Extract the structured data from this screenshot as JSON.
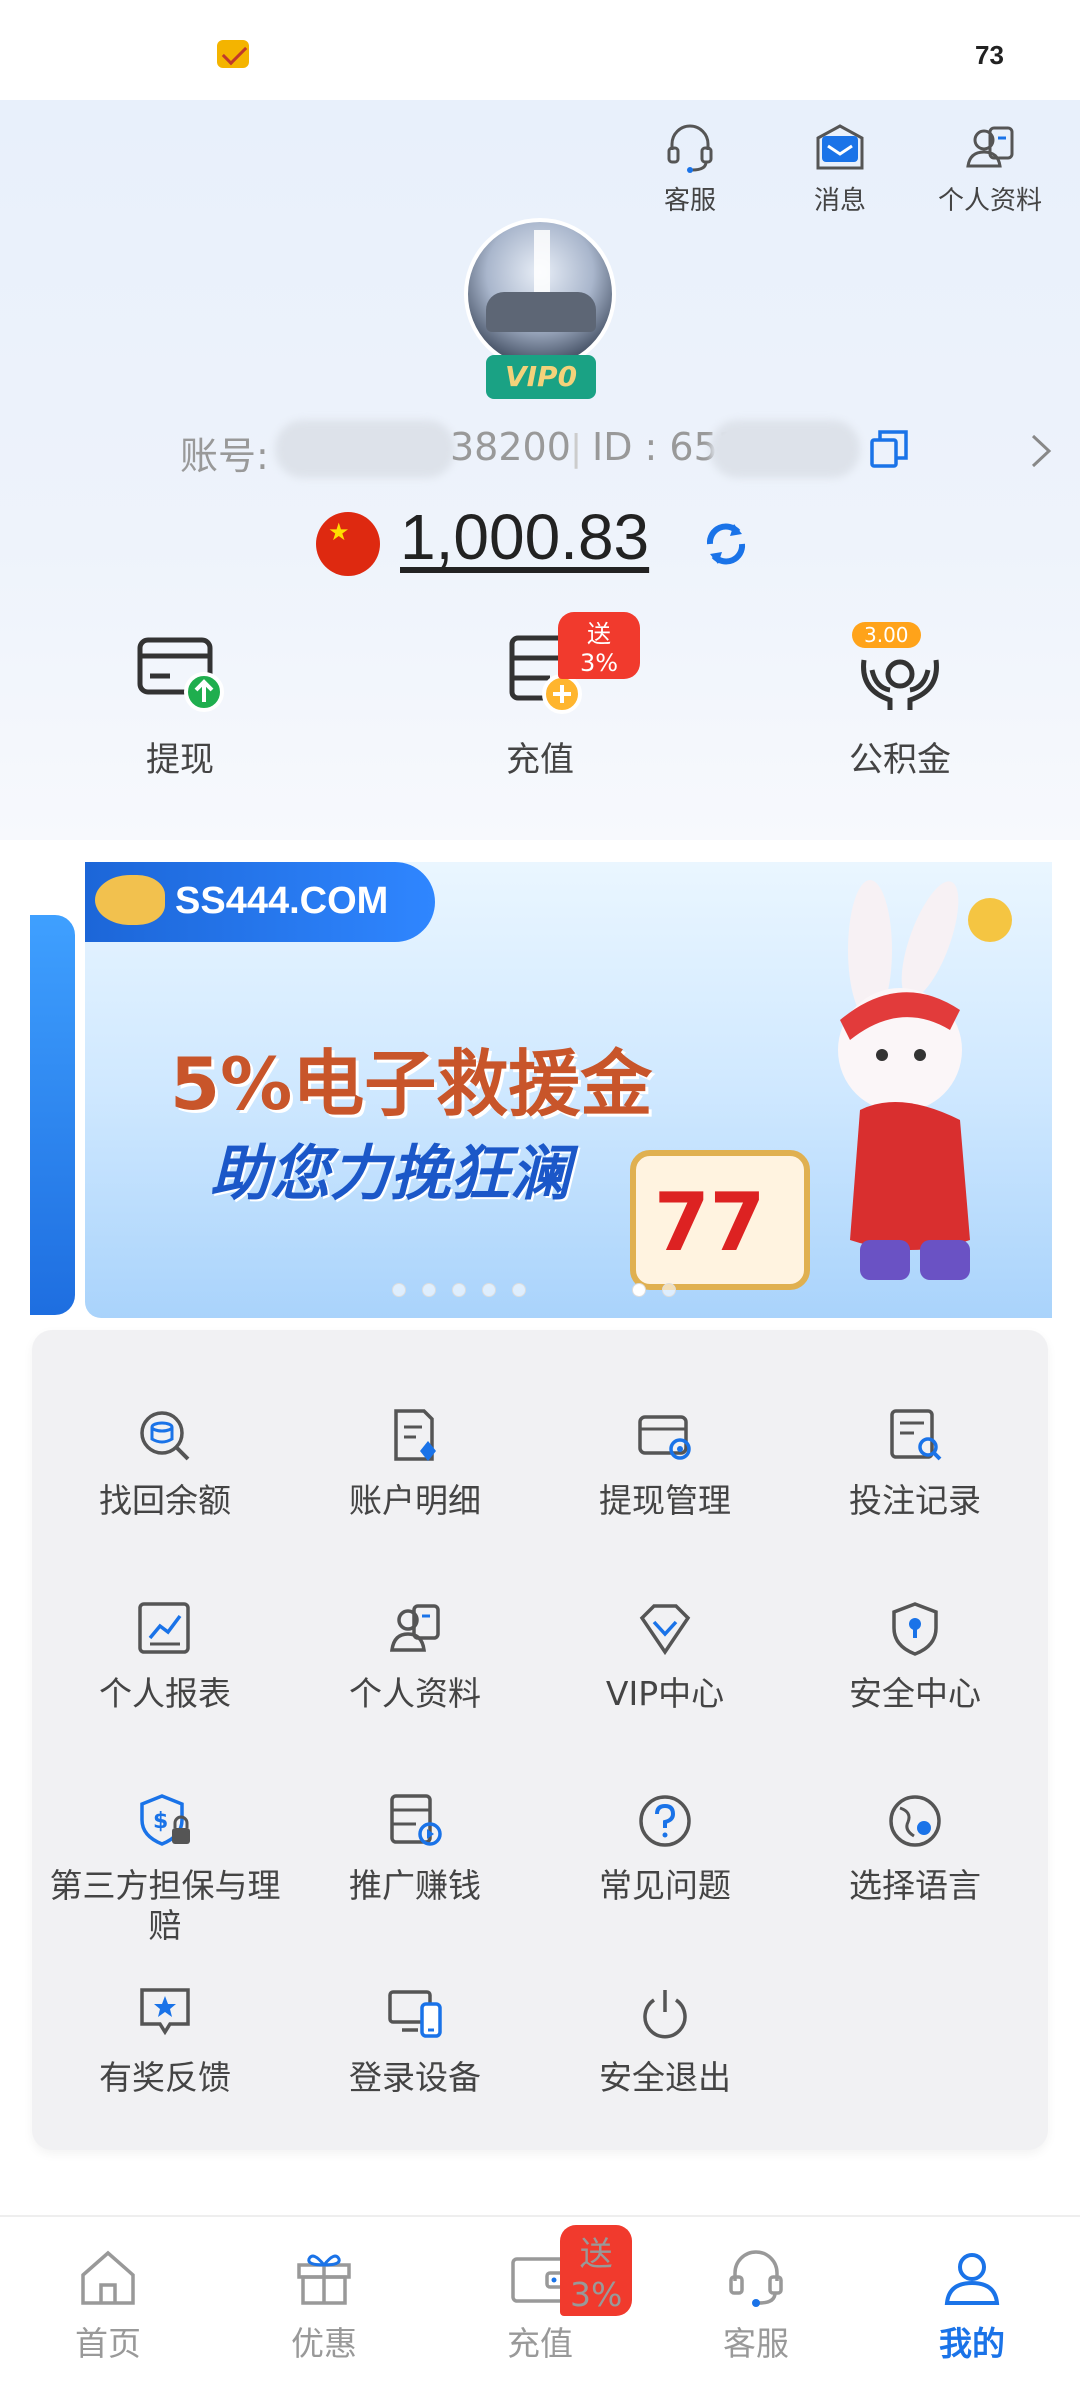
{
  "status_bar": {
    "battery": "73"
  },
  "header": {
    "actions": [
      {
        "label": "客服"
      },
      {
        "label": "消息"
      },
      {
        "label": "个人资料"
      }
    ],
    "vip_label": "VIP0",
    "account_label": "账号:",
    "account_visible_tail": "38200",
    "id_label": "ID : 653",
    "currency_flag": "china-flag-icon",
    "balance": "1,000.83"
  },
  "quick_actions": [
    {
      "label": "提现"
    },
    {
      "label": "充值",
      "badge": "送3%"
    },
    {
      "label": "公积金",
      "badge": "3.00"
    }
  ],
  "banner": {
    "logo_text": "SS444.COM",
    "headline": "5%电子救援金",
    "subline": "助您力挽狂澜",
    "slot_digits": "77"
  },
  "grid": [
    {
      "label": "找回余额"
    },
    {
      "label": "账户明细"
    },
    {
      "label": "提现管理"
    },
    {
      "label": "投注记录"
    },
    {
      "label": "个人报表"
    },
    {
      "label": "个人资料"
    },
    {
      "label": "VIP中心"
    },
    {
      "label": "安全中心"
    },
    {
      "label": "第三方担保与理赔"
    },
    {
      "label": "推广赚钱"
    },
    {
      "label": "常见问题"
    },
    {
      "label": "选择语言"
    },
    {
      "label": "有奖反馈"
    },
    {
      "label": "登录设备"
    },
    {
      "label": "安全退出"
    }
  ],
  "tabbar": [
    {
      "label": "首页"
    },
    {
      "label": "优惠"
    },
    {
      "label": "充值",
      "badge": "送3%"
    },
    {
      "label": "客服"
    },
    {
      "label": "我的",
      "active": true
    }
  ],
  "colors": {
    "accent": "#1a73e8",
    "badge_red": "#f13a2d",
    "badge_orange": "#ffa31a",
    "vip_green": "#1aa284"
  }
}
